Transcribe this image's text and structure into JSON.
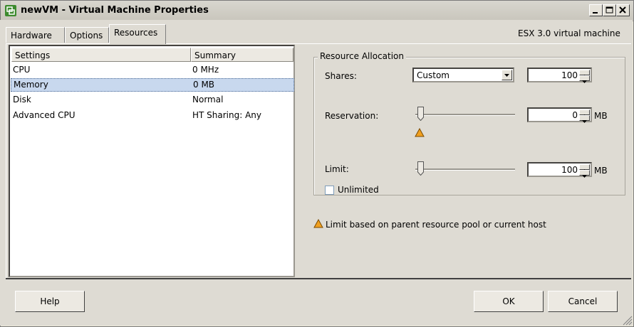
{
  "window": {
    "title": "newVM - Virtual Machine Properties",
    "subtitle": "ESX 3.0 virtual machine",
    "controls": {
      "minimize": "_",
      "maximize": "□",
      "close": "✕"
    }
  },
  "tabs": [
    {
      "label": "Hardware",
      "active": false
    },
    {
      "label": "Options",
      "active": false
    },
    {
      "label": "Resources",
      "active": true
    }
  ],
  "settings_list": {
    "headers": [
      "Settings",
      "Summary"
    ],
    "rows": [
      {
        "setting": "CPU",
        "summary": "0 MHz",
        "selected": false
      },
      {
        "setting": "Memory",
        "summary": "0 MB",
        "selected": true
      },
      {
        "setting": "Disk",
        "summary": "Normal",
        "selected": false
      },
      {
        "setting": "Advanced CPU",
        "summary": "HT Sharing: Any",
        "selected": false
      }
    ]
  },
  "resource_allocation": {
    "legend": "Resource Allocation",
    "shares": {
      "label": "Shares:",
      "selected": "Custom",
      "value": "100"
    },
    "reservation": {
      "label": "Reservation:",
      "value": "0",
      "unit": "MB",
      "slider_level": 0.02
    },
    "limit": {
      "label": "Limit:",
      "value": "100",
      "unit": "MB",
      "slider_level": 0.02
    },
    "unlimited": {
      "label": "Unlimited",
      "checked": false
    },
    "note": "Limit based on parent resource pool or current host"
  },
  "buttons": {
    "help": "Help",
    "ok": "OK",
    "cancel": "Cancel"
  },
  "colors": {
    "warning": "#f0a020",
    "selection": "#c8d8ee"
  }
}
